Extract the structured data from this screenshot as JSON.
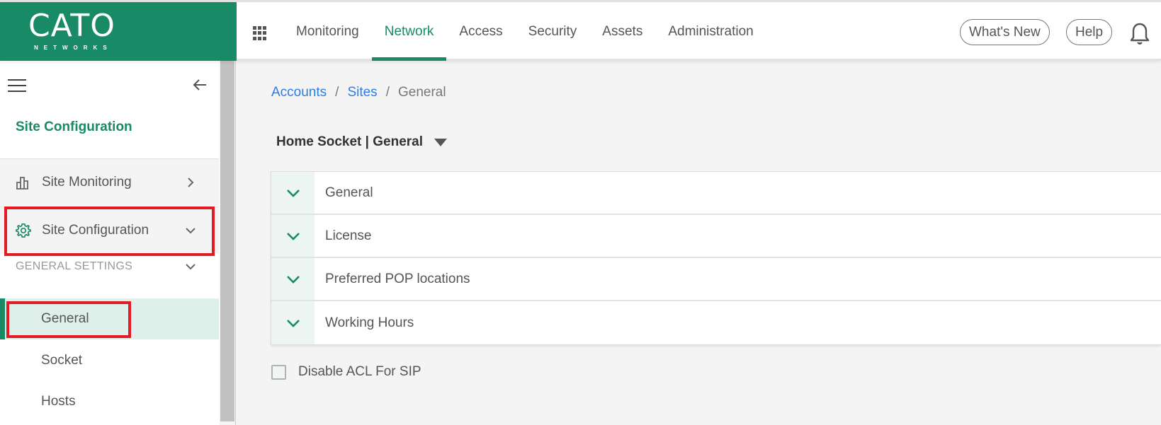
{
  "brand": {
    "name": "CATO",
    "subtitle": "NETWORKS",
    "color": "#188a66"
  },
  "topnav": {
    "apps_icon": "grid-icon",
    "items": [
      {
        "label": "Monitoring",
        "active": false
      },
      {
        "label": "Network",
        "active": true
      },
      {
        "label": "Access",
        "active": false
      },
      {
        "label": "Security",
        "active": false
      },
      {
        "label": "Assets",
        "active": false
      },
      {
        "label": "Administration",
        "active": false
      }
    ],
    "whats_new_label": "What's New",
    "help_label": "Help",
    "notifications_icon": "bell-icon"
  },
  "sidebar": {
    "menu_icon": "hamburger-icon",
    "collapse_icon": "arrow-left-icon",
    "title": "Site Configuration",
    "groups": [
      {
        "label": "Site Monitoring",
        "icon": "bar-chart-icon",
        "chevron": "chevron-right-icon"
      },
      {
        "label": "Site Configuration",
        "icon": "gear-icon",
        "chevron": "chevron-down-icon"
      }
    ],
    "section_header": "GENERAL SETTINGS",
    "items": [
      {
        "label": "General",
        "active": true
      },
      {
        "label": "Socket",
        "active": false
      },
      {
        "label": "Hosts",
        "active": false
      }
    ]
  },
  "breadcrumb": {
    "items": [
      {
        "label": "Accounts",
        "link": true
      },
      {
        "label": "Sites",
        "link": true
      },
      {
        "label": "General",
        "link": false
      }
    ],
    "separator": "/"
  },
  "site_selector": {
    "value": "Home Socket | General"
  },
  "accordion": {
    "sections": [
      {
        "title": "General",
        "expanded": false
      },
      {
        "title": "License",
        "expanded": false
      },
      {
        "title": "Preferred POP locations",
        "expanded": false
      },
      {
        "title": "Working Hours",
        "expanded": false
      }
    ]
  },
  "options": {
    "disable_acl_sip": {
      "label": "Disable ACL For SIP",
      "checked": false
    }
  },
  "colors": {
    "accent": "#188a66",
    "link": "#2b7de9",
    "highlight": "#e21b25",
    "active_bg": "#dff0eb"
  }
}
